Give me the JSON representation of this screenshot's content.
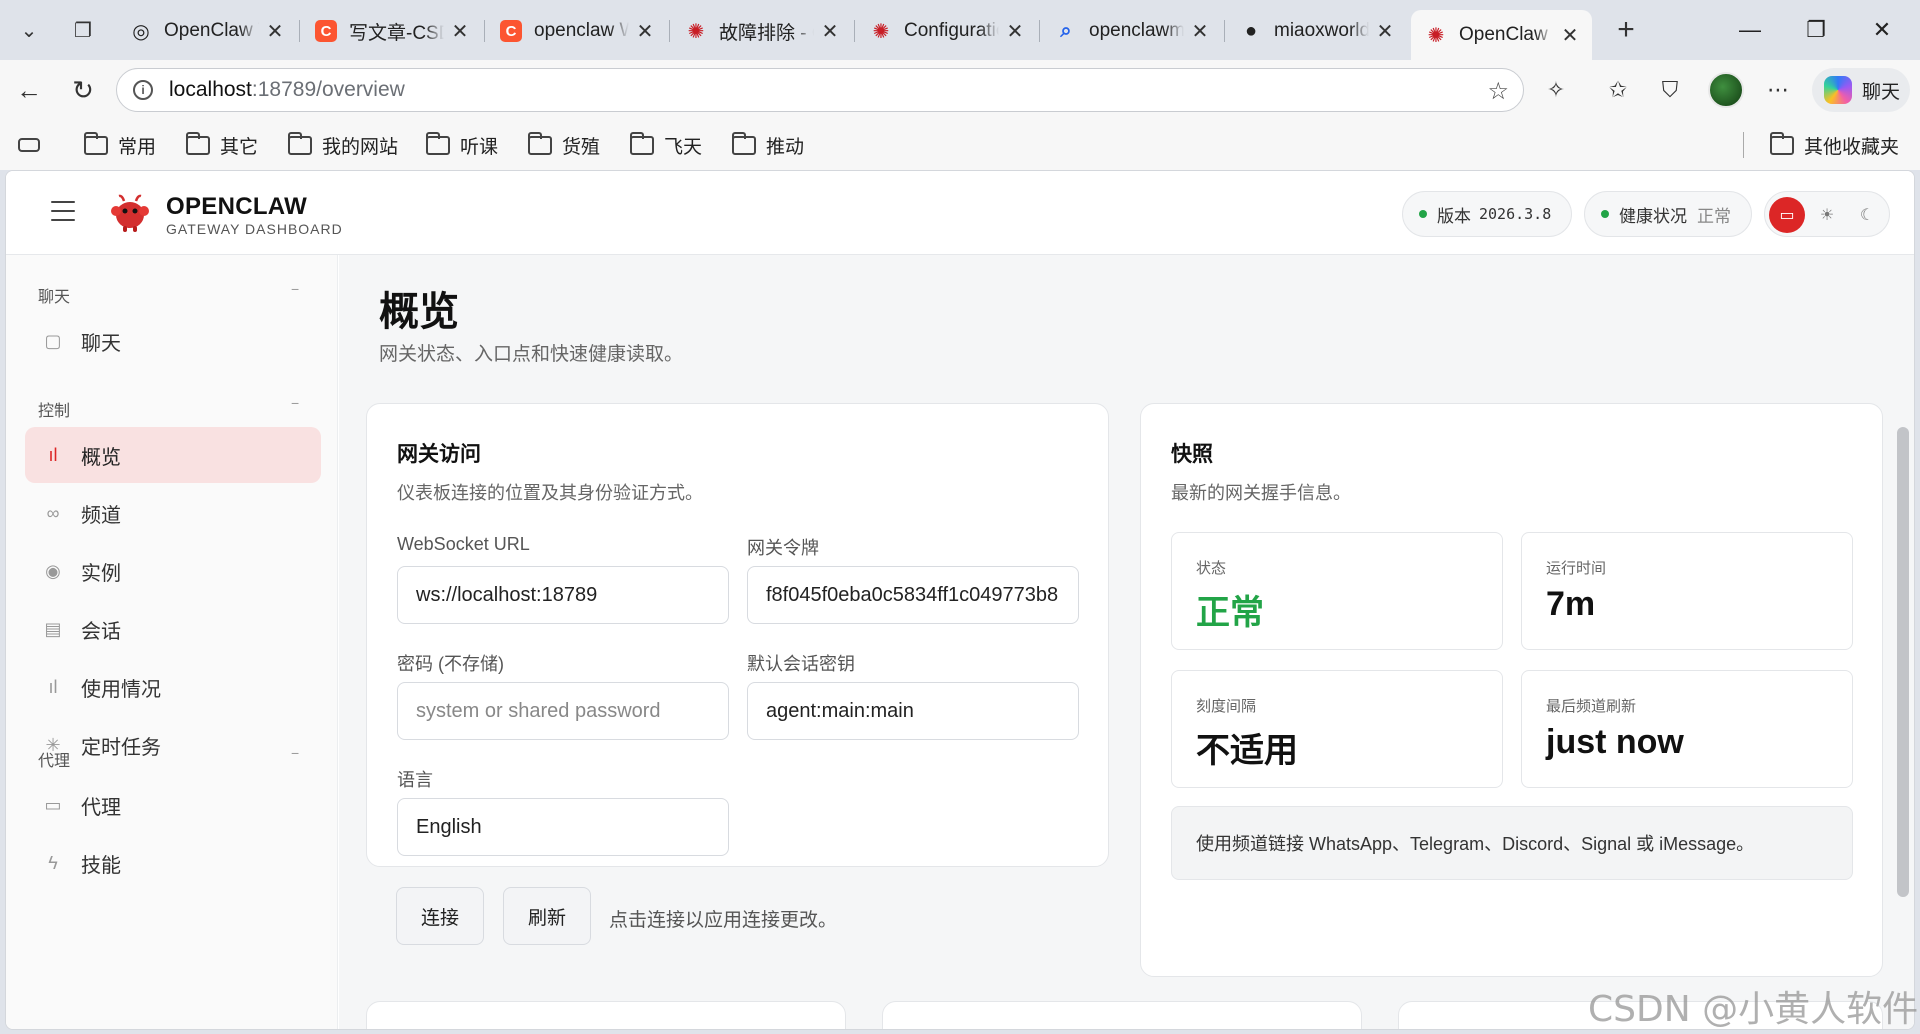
{
  "browser": {
    "tabs": [
      {
        "label": "OpenClaw Tools",
        "icon": "openai-icon",
        "color": "#222222",
        "glyph": "◎",
        "active": false
      },
      {
        "label": "写文章-CSDN博客",
        "icon": "csdn-icon",
        "color": "#fc5531",
        "glyph": "C",
        "active": false
      },
      {
        "label": "openclaw Windows",
        "icon": "csdn-icon",
        "color": "#fc5531",
        "glyph": "C",
        "active": false
      },
      {
        "label": "故障排除 - OpenClaw",
        "icon": "openclaw-icon",
        "color": "#c81d25",
        "glyph": "✺",
        "active": false
      },
      {
        "label": "Configuration",
        "icon": "openclaw-icon",
        "color": "#c81d25",
        "glyph": "✺",
        "active": false
      },
      {
        "label": "openclawmarket",
        "icon": "search-icon",
        "color": "#2563eb",
        "glyph": "⌕",
        "active": false
      },
      {
        "label": "miaoxworld/",
        "icon": "github-icon",
        "color": "#222222",
        "glyph": "●",
        "active": false
      },
      {
        "label": "OpenClaw Control",
        "icon": "openclaw-icon",
        "color": "#c81d25",
        "glyph": "✺",
        "active": true
      }
    ],
    "address": {
      "host": "localhost",
      "port_path": ":18789/overview"
    },
    "copilot_label": "聊天",
    "bookmarks": [
      "常用",
      "其它",
      "我的网站",
      "听课",
      "货殖",
      "飞天",
      "推动"
    ],
    "other_bookmarks": "其他收藏夹"
  },
  "app": {
    "brand": {
      "name": "OPENCLAW",
      "subtitle": "GATEWAY DASHBOARD"
    },
    "version": {
      "label": "版本",
      "value": "2026.3.8"
    },
    "health": {
      "label": "健康状况",
      "value": "正常"
    },
    "accent_color": "#dc2626",
    "ok_color": "#22a447"
  },
  "sidebar": {
    "sections": [
      {
        "title": "聊天",
        "toggle": "−",
        "items": [
          {
            "label": "聊天",
            "icon": "chat-icon",
            "glyph": "▢",
            "active": false
          }
        ]
      },
      {
        "title": "控制",
        "toggle": "−",
        "items": [
          {
            "label": "概览",
            "icon": "bar-chart-icon",
            "glyph": "ıl",
            "active": true
          },
          {
            "label": "频道",
            "icon": "link-icon",
            "glyph": "∞",
            "active": false
          },
          {
            "label": "实例",
            "icon": "broadcast-icon",
            "glyph": "◉",
            "active": false
          },
          {
            "label": "会话",
            "icon": "document-icon",
            "glyph": "▤",
            "active": false
          },
          {
            "label": "使用情况",
            "icon": "usage-chart-icon",
            "glyph": "ıl",
            "active": false
          },
          {
            "label": "定时任务",
            "icon": "loader-icon",
            "glyph": "✳",
            "active": false
          }
        ]
      },
      {
        "title": "代理",
        "toggle": "−",
        "items": [
          {
            "label": "代理",
            "icon": "folder-icon",
            "glyph": "▭",
            "active": false
          },
          {
            "label": "技能",
            "icon": "lightning-icon",
            "glyph": "ϟ",
            "active": false
          }
        ]
      }
    ]
  },
  "main": {
    "title": "概览",
    "subtitle": "网关状态、入口点和快速健康读取。",
    "gateway_access": {
      "title": "网关访问",
      "subtitle": "仪表板连接的位置及其身份验证方式。",
      "websocket_label": "WebSocket URL",
      "websocket_value": "ws://localhost:18789",
      "token_label": "网关令牌",
      "token_value": "f8f045f0eba0c5834ff1c049773b8",
      "password_label": "密码 (不存储)",
      "password_placeholder": "system or shared password",
      "session_key_label": "默认会话密钥",
      "session_key_value": "agent:main:main",
      "language_label": "语言",
      "language_value": "English",
      "connect_label": "连接",
      "refresh_label": "刷新",
      "hint": "点击连接以应用连接更改。"
    },
    "snapshot": {
      "title": "快照",
      "subtitle": "最新的网关握手信息。",
      "stats": [
        {
          "label": "状态",
          "value": "正常",
          "ok": true
        },
        {
          "label": "运行时间",
          "value": "7m",
          "ok": false
        },
        {
          "label": "刻度间隔",
          "value": "不适用",
          "ok": false
        },
        {
          "label": "最后频道刷新",
          "value": "just now",
          "ok": false
        }
      ],
      "banner": "使用频道链接 WhatsApp、Telegram、Discord、Signal 或 iMessage。"
    }
  },
  "watermark": "CSDN @小黄人软件"
}
